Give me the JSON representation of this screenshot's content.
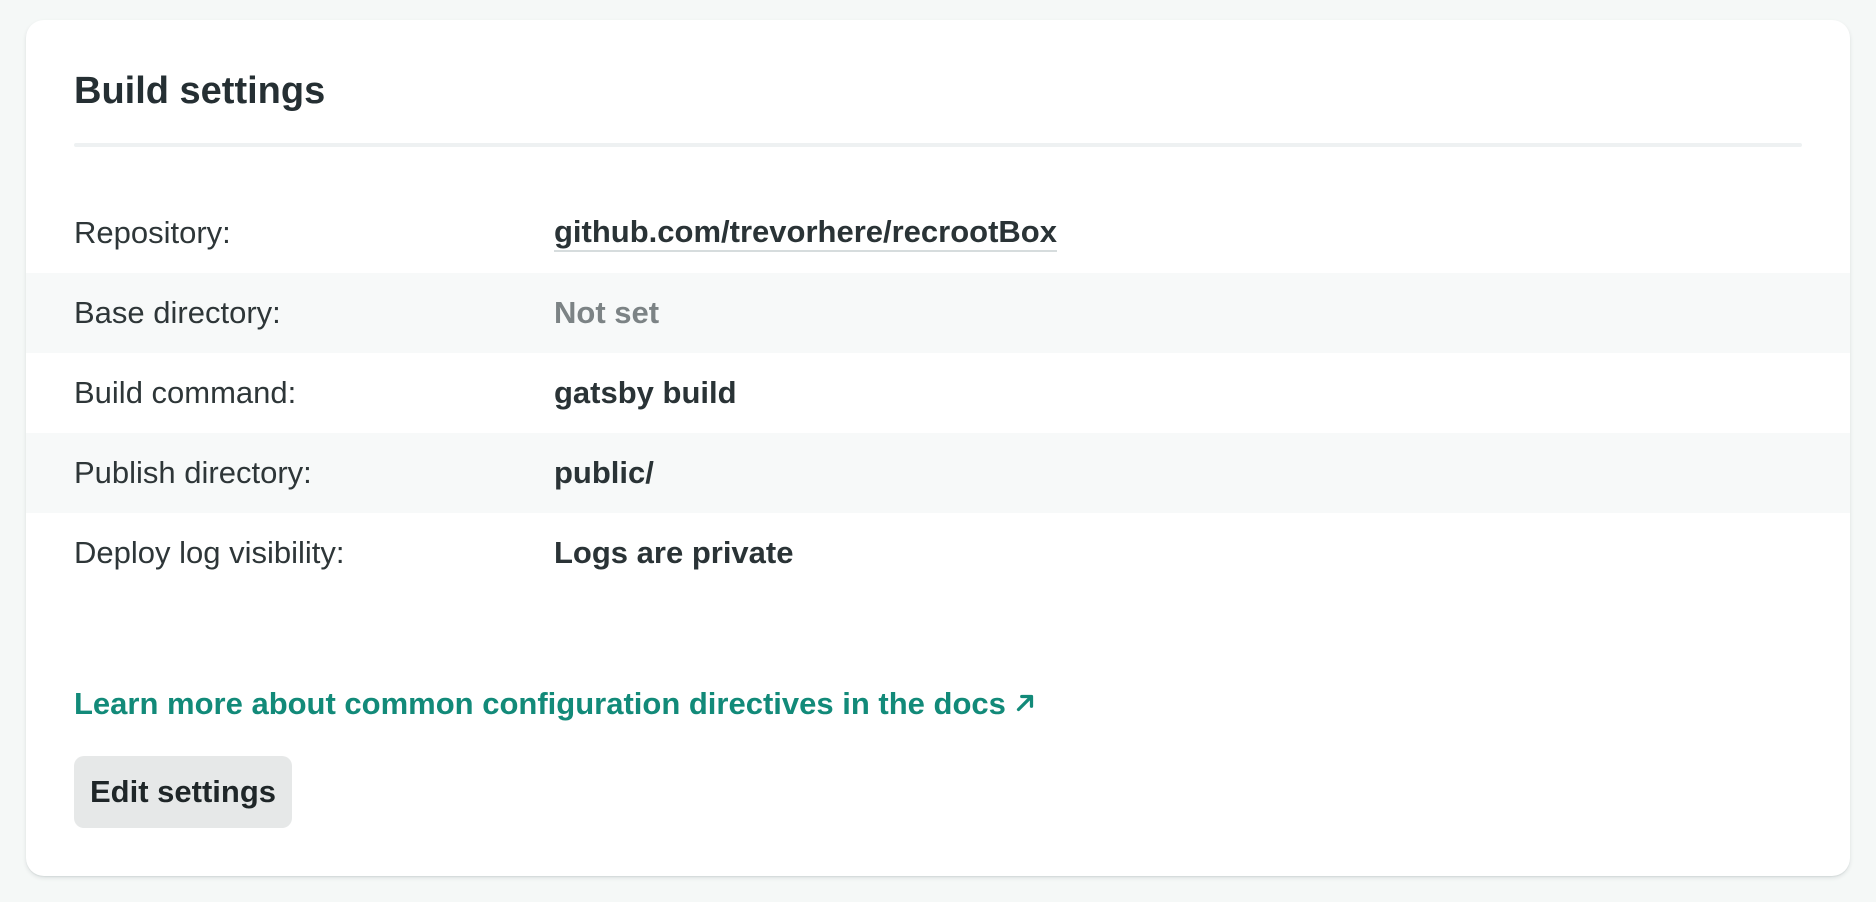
{
  "card": {
    "title": "Build settings"
  },
  "rows": [
    {
      "label": "Repository:",
      "value": "github.com/trevorhere/recrootBox"
    },
    {
      "label": "Base directory:",
      "value": "Not set"
    },
    {
      "label": "Build command:",
      "value": "gatsby build"
    },
    {
      "label": "Publish directory:",
      "value": "public/"
    },
    {
      "label": "Deploy log visibility:",
      "value": "Logs are private"
    }
  ],
  "docs_link": {
    "text": "Learn more about common configuration directives in the docs",
    "icon": "external-link-arrow-icon"
  },
  "actions": {
    "edit_label": "Edit settings"
  },
  "colors": {
    "accent": "#128a79",
    "muted": "#7c8385",
    "alt_row": "#f7f9f9",
    "button_bg": "#e6e8e8"
  }
}
